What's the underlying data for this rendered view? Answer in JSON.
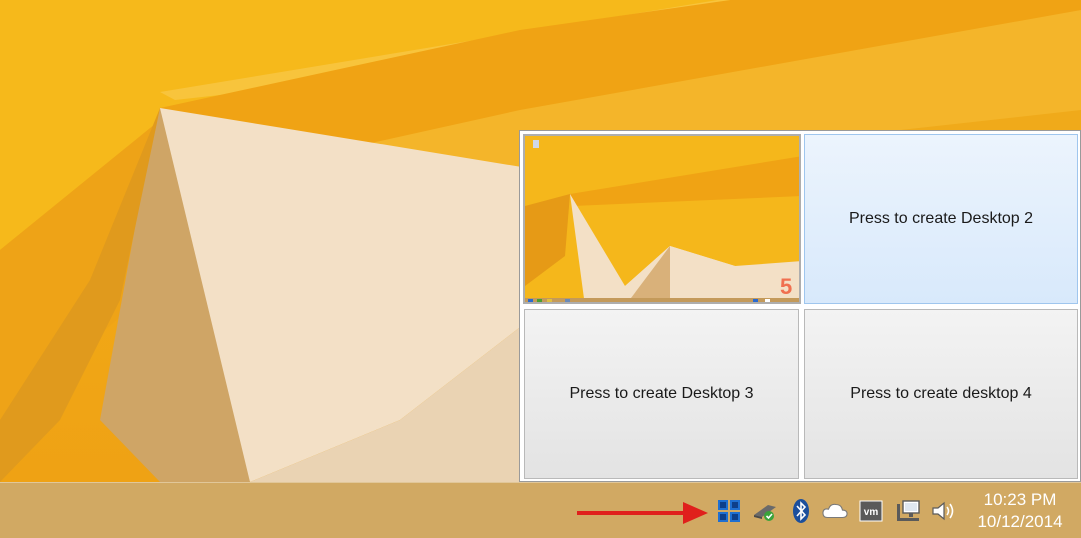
{
  "desktop": {
    "wallpaper": "orange-geometric",
    "colors": {
      "orange": "#f2a916",
      "cream": "#f3e0c6",
      "shadow": "#b8904a"
    }
  },
  "switcher": {
    "tiles": [
      {
        "label": "",
        "state": "current-desktop-thumbnail",
        "badge": "5"
      },
      {
        "label": "Press to create Desktop 2"
      },
      {
        "label": "Press to create Desktop 3"
      },
      {
        "label": "Press to create desktop 4"
      }
    ]
  },
  "taskbar": {
    "tray_icons": [
      "virtual-desktops-icon",
      "usb-safely-remove-icon",
      "bluetooth-icon",
      "onedrive-cloud-icon",
      "vmware-icon",
      "network-icon",
      "volume-icon"
    ],
    "clock": {
      "time": "10:23 PM",
      "date": "10/12/2014"
    }
  },
  "annotation": {
    "arrow_color": "#e0201c"
  }
}
